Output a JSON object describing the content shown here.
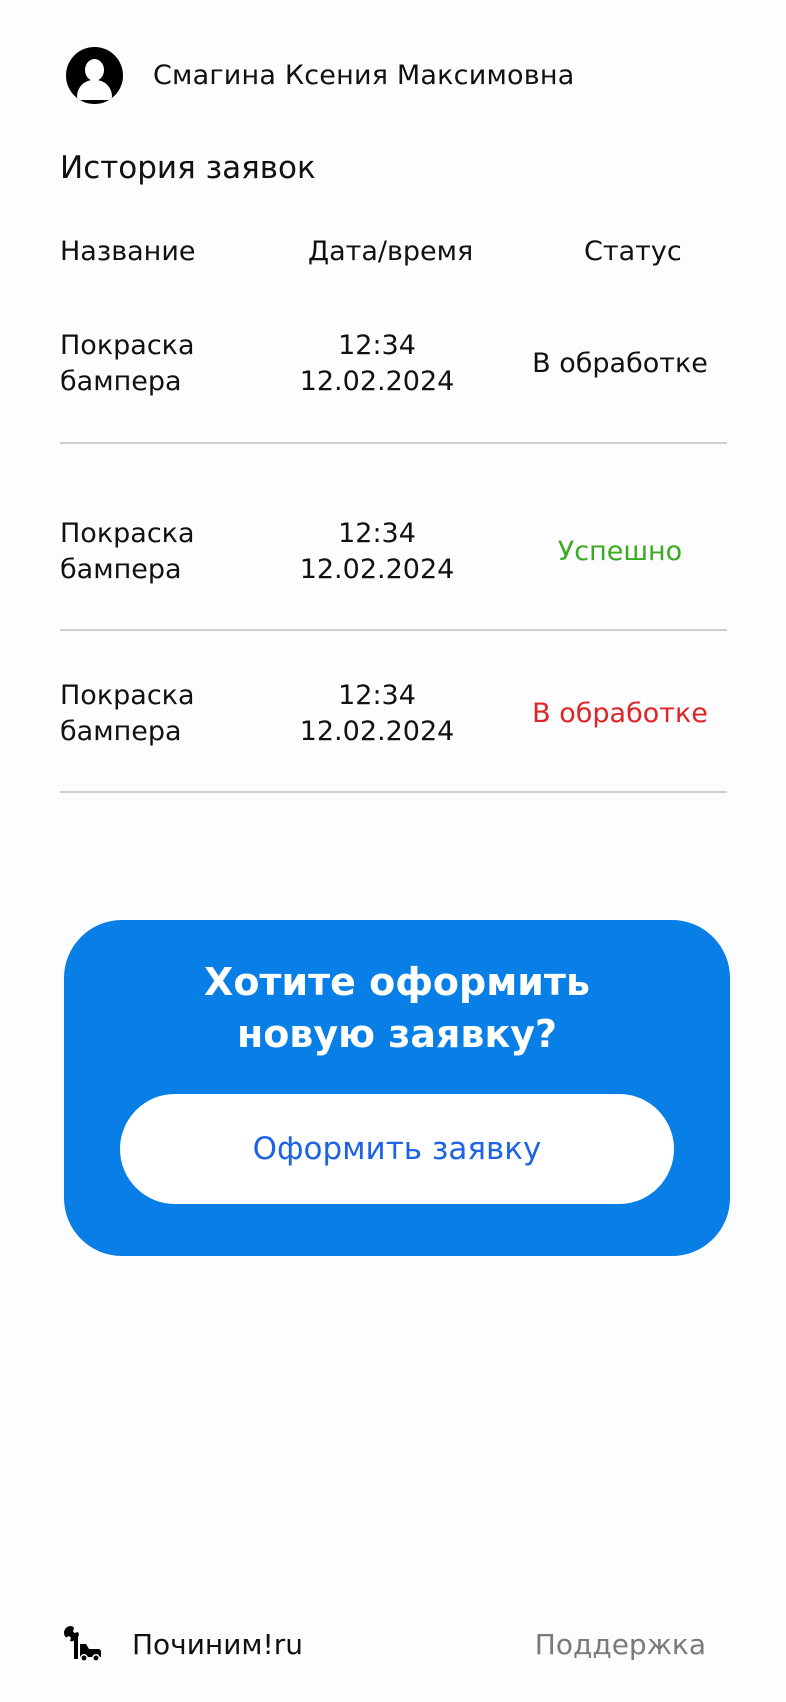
{
  "user": {
    "full_name": "Смагина Ксения Максимовна",
    "avatar_icon": "user-avatar-icon"
  },
  "history": {
    "title": "История заявок",
    "columns": {
      "name": "Название",
      "datetime": "Дата/время",
      "status": "Статус"
    },
    "rows": [
      {
        "name_line1": "Покраска",
        "name_line2": "бампера",
        "time": "12:34",
        "date": "12.02.2024",
        "status": "В обработке",
        "status_color": "#111111"
      },
      {
        "name_line1": "Покраска",
        "name_line2": "бампера",
        "time": "12:34",
        "date": "12.02.2024",
        "status": "Успешно",
        "status_color": "#3aab1f"
      },
      {
        "name_line1": "Покраска",
        "name_line2": "бампера",
        "time": "12:34",
        "date": "12.02.2024",
        "status": "В обработке",
        "status_color": "#e02424"
      }
    ]
  },
  "cta": {
    "title_line1": "Хотите оформить",
    "title_line2": "новую заявку?",
    "button_label": "Оформить заявку",
    "background_color": "#077fe6",
    "button_text_color": "#1e63e6"
  },
  "footer": {
    "logo_icon": "wrench-car-icon",
    "brand": "Починим!ru",
    "support_link": "Поддержка"
  }
}
